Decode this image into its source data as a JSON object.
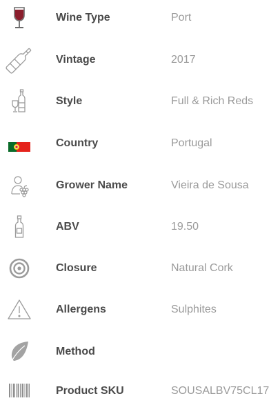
{
  "details": [
    {
      "icon": "wine-glass-icon",
      "label": "Wine Type",
      "value": "Port"
    },
    {
      "icon": "wine-bottle-icon",
      "label": "Vintage",
      "value": "2017"
    },
    {
      "icon": "bottle-and-glass-icon",
      "label": "Style",
      "value": "Full & Rich Reds"
    },
    {
      "icon": "portugal-flag-icon",
      "label": "Country",
      "value": "Portugal"
    },
    {
      "icon": "grower-grapes-icon",
      "label": "Grower Name",
      "value": "Vieira de Sousa"
    },
    {
      "icon": "small-bottle-icon",
      "label": "ABV",
      "value": "19.50"
    },
    {
      "icon": "closure-ring-icon",
      "label": "Closure",
      "value": "Natural Cork"
    },
    {
      "icon": "warning-triangle-icon",
      "label": "Allergens",
      "value": "Sulphites"
    },
    {
      "icon": "leaf-icon",
      "label": "Method",
      "value": ""
    },
    {
      "icon": "barcode-icon",
      "label": "Product SKU",
      "value": "SOUSALBV75CL17"
    }
  ],
  "colors": {
    "label": "#4a4a4a",
    "value": "#9a9a9a",
    "icon": "#9b9b9b",
    "wine": "#8b1e2d",
    "flag_green": "#0a6b2a",
    "flag_red": "#e5231c"
  }
}
